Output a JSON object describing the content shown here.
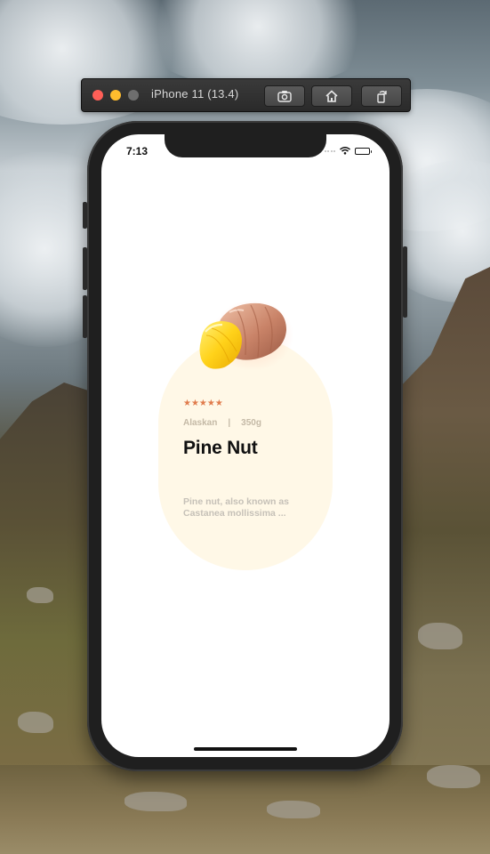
{
  "simulator": {
    "title": "iPhone 11 (13.4)",
    "buttons": [
      {
        "icon": "screenshot-icon"
      },
      {
        "icon": "home-icon"
      },
      {
        "icon": "rotate-icon"
      }
    ],
    "traffic_lights": {
      "close": "#ff5f57",
      "minimize": "#febc2e",
      "maximize": "#6e6e6e"
    }
  },
  "status_bar": {
    "time": "7:13",
    "icons": [
      "signal-icon",
      "wifi-icon",
      "battery-icon"
    ]
  },
  "product": {
    "rating": "★★★★★",
    "origin": "Alaskan",
    "separator": "|",
    "weight": "350g",
    "name": "Pine Nut",
    "description": "Pine nut, also known as Castanea mollissima ...",
    "image_icon": "nut-illustration-icon"
  },
  "colors": {
    "card_background": "#fff8e7",
    "star": "#e07b4c",
    "meta_text": "#c4b9a6",
    "title": "#111111"
  }
}
